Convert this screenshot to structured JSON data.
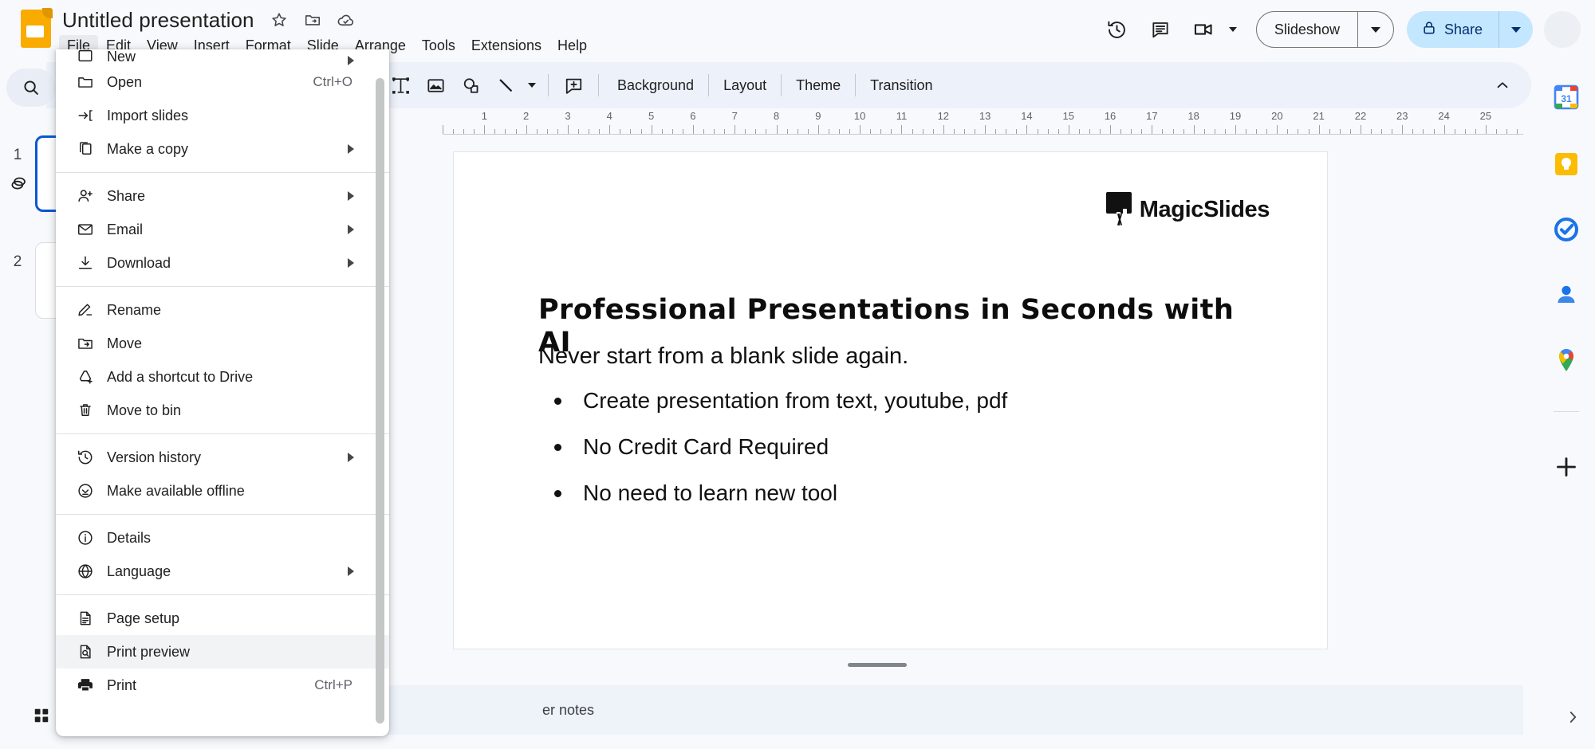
{
  "app": {
    "product": "Google Slides",
    "doc_title": "Untitled presentation",
    "title_icons": [
      "star-icon",
      "move-to-folder-icon",
      "cloud-saved-icon"
    ]
  },
  "menubar": {
    "items": [
      {
        "label": "File",
        "active": true
      },
      {
        "label": "Edit",
        "active": false
      },
      {
        "label": "View",
        "active": false
      },
      {
        "label": "Insert",
        "active": false
      },
      {
        "label": "Format",
        "active": false
      },
      {
        "label": "Slide",
        "active": false
      },
      {
        "label": "Arrange",
        "active": false
      },
      {
        "label": "Tools",
        "active": false
      },
      {
        "label": "Extensions",
        "active": false
      },
      {
        "label": "Help",
        "active": false
      }
    ]
  },
  "top_right": {
    "history_icon": "version-history-icon",
    "comment_icon": "comment-history-icon",
    "meet_icon": "google-meet-icon",
    "slideshow_label": "Slideshow",
    "share_label": "Share",
    "share_bg": "#c2e7ff",
    "share_fg": "#062e6f"
  },
  "toolbar": {
    "icons": [
      "textbox-icon",
      "insert-image-icon",
      "shape-icon",
      "line-icon",
      "comment-add-icon"
    ],
    "text_buttons": [
      "Background",
      "Layout",
      "Theme",
      "Transition"
    ],
    "collapse_icon": "chevron-up-icon"
  },
  "left_rail": {
    "search_icon": "search-icon"
  },
  "filmstrip": {
    "slides": [
      {
        "number": "1",
        "selected": true,
        "has_transition_icon": true
      },
      {
        "number": "2",
        "selected": false,
        "has_transition_icon": false
      }
    ]
  },
  "ruler": {
    "unit_labels": [
      "1",
      "2",
      "3",
      "4",
      "5",
      "6",
      "7",
      "8",
      "9",
      "10",
      "11",
      "12",
      "13",
      "14",
      "15",
      "16",
      "17",
      "18",
      "19",
      "20",
      "21",
      "22",
      "23",
      "24",
      "25"
    ]
  },
  "slide": {
    "logo_text": "MagicSlides",
    "title": "Professional Presentations in Seconds with AI",
    "subtitle": "Never start from a blank slide again.",
    "bullets": [
      "Create presentation from text, youtube, pdf",
      "No Credit Card Required",
      "No need to learn new tool"
    ]
  },
  "notes": {
    "placeholder": "Click to add speaker notes",
    "visible_text": "er notes",
    "grid_icon": "grid-view-icon"
  },
  "right_rail": {
    "icons": [
      {
        "name": "google-calendar-icon",
        "label": "Calendar"
      },
      {
        "name": "google-keep-icon",
        "label": "Keep"
      },
      {
        "name": "google-tasks-icon",
        "label": "Tasks"
      },
      {
        "name": "google-contacts-icon",
        "label": "Contacts"
      },
      {
        "name": "google-maps-icon",
        "label": "Maps"
      }
    ],
    "add_icon": "plus-icon",
    "expand_icon": "chevron-right-icon"
  },
  "file_menu": {
    "groups": [
      {
        "items": [
          {
            "label": "New",
            "icon": "new-icon",
            "submenu": true,
            "shortcut": "",
            "clipped": true
          },
          {
            "label": "Open",
            "icon": "folder-open-icon",
            "submenu": false,
            "shortcut": "Ctrl+O"
          },
          {
            "label": "Import slides",
            "icon": "import-slides-icon",
            "submenu": false,
            "shortcut": ""
          },
          {
            "label": "Make a copy",
            "icon": "copy-icon",
            "submenu": true,
            "shortcut": ""
          }
        ]
      },
      {
        "items": [
          {
            "label": "Share",
            "icon": "person-add-icon",
            "submenu": true,
            "shortcut": ""
          },
          {
            "label": "Email",
            "icon": "email-icon",
            "submenu": true,
            "shortcut": ""
          },
          {
            "label": "Download",
            "icon": "download-icon",
            "submenu": true,
            "shortcut": ""
          }
        ]
      },
      {
        "items": [
          {
            "label": "Rename",
            "icon": "rename-pencil-icon",
            "submenu": false,
            "shortcut": ""
          },
          {
            "label": "Move",
            "icon": "move-folder-icon",
            "submenu": false,
            "shortcut": ""
          },
          {
            "label": "Add a shortcut to Drive",
            "icon": "add-shortcut-drive-icon",
            "submenu": false,
            "shortcut": ""
          },
          {
            "label": "Move to bin",
            "icon": "trash-icon",
            "submenu": false,
            "shortcut": ""
          }
        ]
      },
      {
        "items": [
          {
            "label": "Version history",
            "icon": "version-history-icon",
            "submenu": true,
            "shortcut": ""
          },
          {
            "label": "Make available offline",
            "icon": "offline-check-icon",
            "submenu": false,
            "shortcut": ""
          }
        ]
      },
      {
        "items": [
          {
            "label": "Details",
            "icon": "info-icon",
            "submenu": false,
            "shortcut": ""
          },
          {
            "label": "Language",
            "icon": "globe-icon",
            "submenu": true,
            "shortcut": ""
          }
        ]
      },
      {
        "items": [
          {
            "label": "Page setup",
            "icon": "page-setup-icon",
            "submenu": false,
            "shortcut": ""
          },
          {
            "label": "Print preview",
            "icon": "print-preview-icon",
            "submenu": false,
            "shortcut": "",
            "highlighted": true
          },
          {
            "label": "Print",
            "icon": "printer-icon",
            "submenu": false,
            "shortcut": "Ctrl+P"
          }
        ]
      }
    ]
  }
}
